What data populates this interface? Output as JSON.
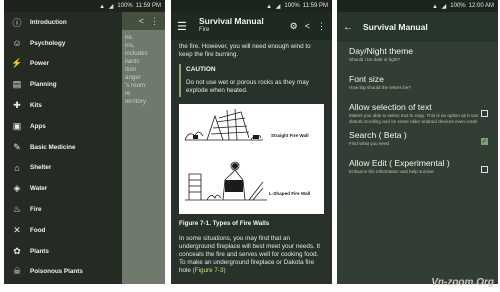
{
  "status": {
    "p1": {
      "battery": "100%",
      "time": "11:59 PM"
    },
    "p2": {
      "battery": "100%",
      "time": "11:59 PM"
    },
    "p3": {
      "battery": "100%",
      "time": "12:00 AM"
    }
  },
  "drawer": {
    "items": [
      {
        "label": "Introduction",
        "icon": "info-icon"
      },
      {
        "label": "Psychology",
        "icon": "brain-icon"
      },
      {
        "label": "Power",
        "icon": "power-icon"
      },
      {
        "label": "Planning",
        "icon": "clipboard-icon"
      },
      {
        "label": "Kits",
        "icon": "kit-icon"
      },
      {
        "label": "Apps",
        "icon": "apps-icon"
      },
      {
        "label": "Basic Medicine",
        "icon": "medicine-icon"
      },
      {
        "label": "Shelter",
        "icon": "shelter-icon"
      },
      {
        "label": "Water",
        "icon": "water-icon"
      },
      {
        "label": "Fire",
        "icon": "fire-icon"
      },
      {
        "label": "Food",
        "icon": "food-icon"
      },
      {
        "label": "Plants",
        "icon": "plant-icon"
      },
      {
        "label": "Poisonous Plants",
        "icon": "poison-icon"
      }
    ],
    "background_lines": [
      "ire.",
      "ins,",
      "includes",
      "ilants",
      "ition",
      "anger",
      "'s room",
      "re",
      "territory"
    ]
  },
  "manual": {
    "title": "Survival Manual",
    "subtitle": "Fire",
    "intro": "the fire. However, you will need enough wind to keep the fire burning.",
    "caution_title": "CAUTION",
    "caution_text": "Do not use wet or porous rocks as they may explode when heated.",
    "figure_labels": {
      "top": "Straight Fire Wall",
      "bottom": "L-Shaped Fire Wall"
    },
    "figure_caption": "Figure 7-1. Types of Fire Walls",
    "paragraph": "In some situations, you may find that an underground fireplace will best meet your needs. It conceals the fire and serves well for cooking food. To make an underground fireplace or Dakota fire hole",
    "paragraph_link": "(Figure 7-3)"
  },
  "settings": {
    "title": "Survival Manual",
    "items": [
      {
        "title": "Day/Night theme",
        "summary": "Should I be dark or light?",
        "checkbox": false
      },
      {
        "title": "Font size",
        "summary": "How big should the letters be?",
        "checkbox": false
      },
      {
        "title": "Allow selection of text",
        "summary": "Makes you able to select text to copy. This is an option as it can disturb scrolling and on some older android devices even crash",
        "checkbox": true,
        "checked": false
      },
      {
        "title": "Search ( Beta )",
        "summary": "Find what you need",
        "checkbox": true,
        "checked": true
      },
      {
        "title": "Allow Edit ( Experimental )",
        "summary": "Enhance the information and help survive",
        "checkbox": true,
        "checked": false
      }
    ]
  },
  "watermark": "Vn-zoom.Org"
}
